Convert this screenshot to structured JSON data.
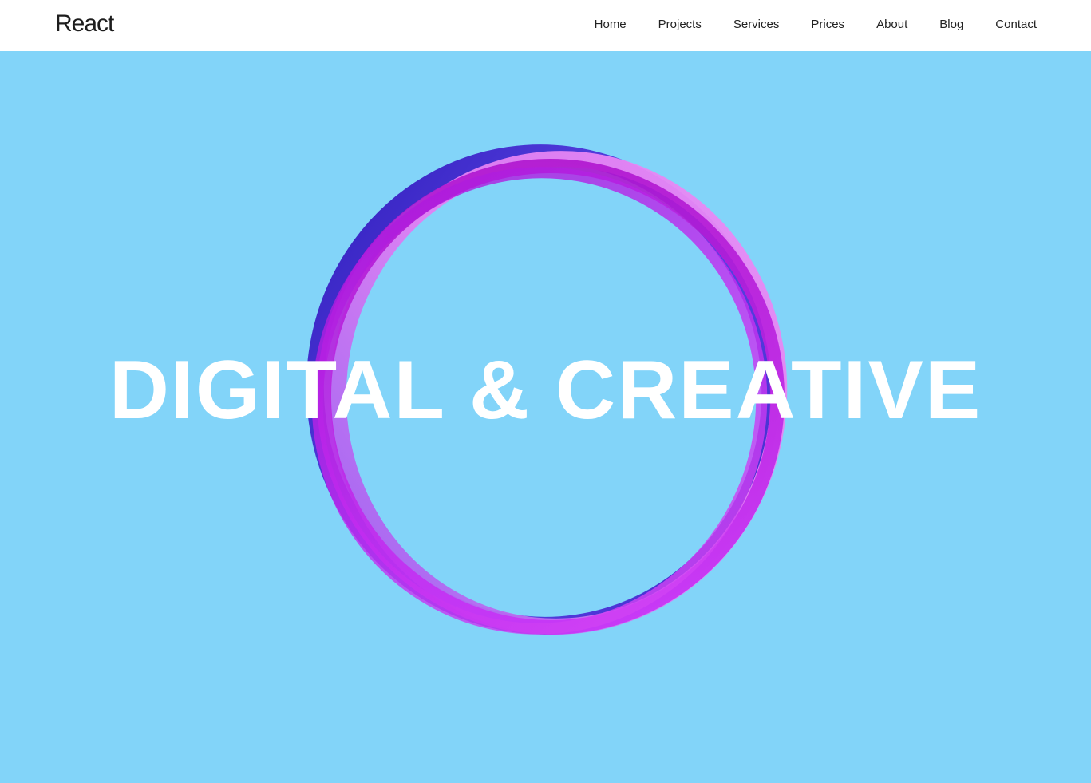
{
  "header": {
    "logo": "React",
    "nav": [
      {
        "label": "Home",
        "active": true
      },
      {
        "label": "Projects",
        "active": false
      },
      {
        "label": "Services",
        "active": false
      },
      {
        "label": "Prices",
        "active": false
      },
      {
        "label": "About",
        "active": false
      },
      {
        "label": "Blog",
        "active": false
      },
      {
        "label": "Contact",
        "active": false
      }
    ]
  },
  "hero": {
    "title": "DIGITAL & CREATIVE",
    "background_color": "#82d4f9",
    "ring_colors": [
      "#3d1fc7",
      "#b01ad8",
      "#e583f3",
      "#c33cf0"
    ]
  }
}
